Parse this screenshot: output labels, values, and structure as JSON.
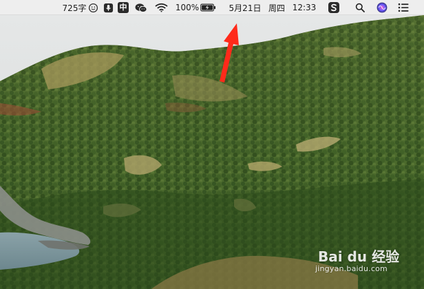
{
  "menubar": {
    "word_count": "725字",
    "battery_percent": "100%",
    "date": "5月21日",
    "weekday": "周四",
    "time": "12:33",
    "input_method_label": "中",
    "icons": {
      "emoji": "emoji-face-icon",
      "voice": "microphone-icon",
      "input_method": "chinese-input-icon",
      "wechat": "wechat-icon",
      "wifi": "wifi-icon",
      "battery": "battery-charging-icon",
      "app_s": "scrivener-s-icon",
      "search": "spotlight-search-icon",
      "siri": "siri-icon",
      "control": "notification-center-icon"
    }
  },
  "annotation": {
    "arrow_color": "#ff2a1a"
  },
  "watermark": {
    "logo": "Bai du 经验",
    "url": "jingyan.baidu.com"
  }
}
